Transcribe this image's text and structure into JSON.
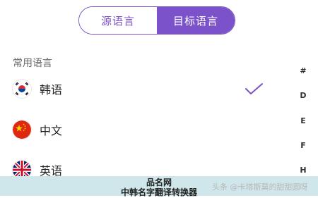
{
  "tabs": {
    "source_label": "源语言",
    "target_label": "目标语言",
    "active": "target",
    "accent_color": "#7b52c9"
  },
  "section": {
    "title": "常用语言"
  },
  "languages": [
    {
      "name": "韩语",
      "flag": "korea-flag-icon",
      "selected": true
    },
    {
      "name": "中文",
      "flag": "china-flag-icon",
      "selected": false
    },
    {
      "name": "英语",
      "flag": "uk-flag-icon",
      "selected": false
    }
  ],
  "index_letters": [
    "#",
    "D",
    "E",
    "F",
    "H"
  ],
  "watermark": {
    "line1": "品名网",
    "line2": "中韩名字翻译转换器",
    "credit": "头条 @卡塔斯莫的甜甜圆呀"
  }
}
